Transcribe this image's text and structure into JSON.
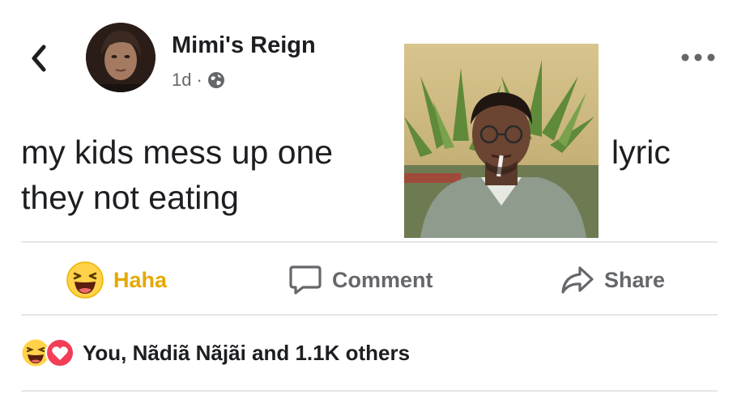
{
  "header": {
    "author_name": "Mimi's Reign",
    "timestamp": "1d",
    "separator": "·",
    "privacy_icon": "globe-icon",
    "back_icon": "chevron-left-icon",
    "more_icon": "more-options-icon"
  },
  "post": {
    "text_line1": "my kids mess up one",
    "text_line1_tail": "lyric",
    "text_line2": "they not eating"
  },
  "actions": {
    "haha_label": "Haha",
    "comment_label": "Comment",
    "share_label": "Share"
  },
  "reactions": {
    "summary": "You, Nãdiã Nãjãi and 1.1K others",
    "icons": [
      "haha-reaction-icon",
      "love-reaction-icon"
    ]
  },
  "colors": {
    "haha": "#e6a800",
    "love": "#f33e58",
    "text": "#1c1e21",
    "secondary": "#65676b",
    "divider": "#e4e6eb"
  }
}
